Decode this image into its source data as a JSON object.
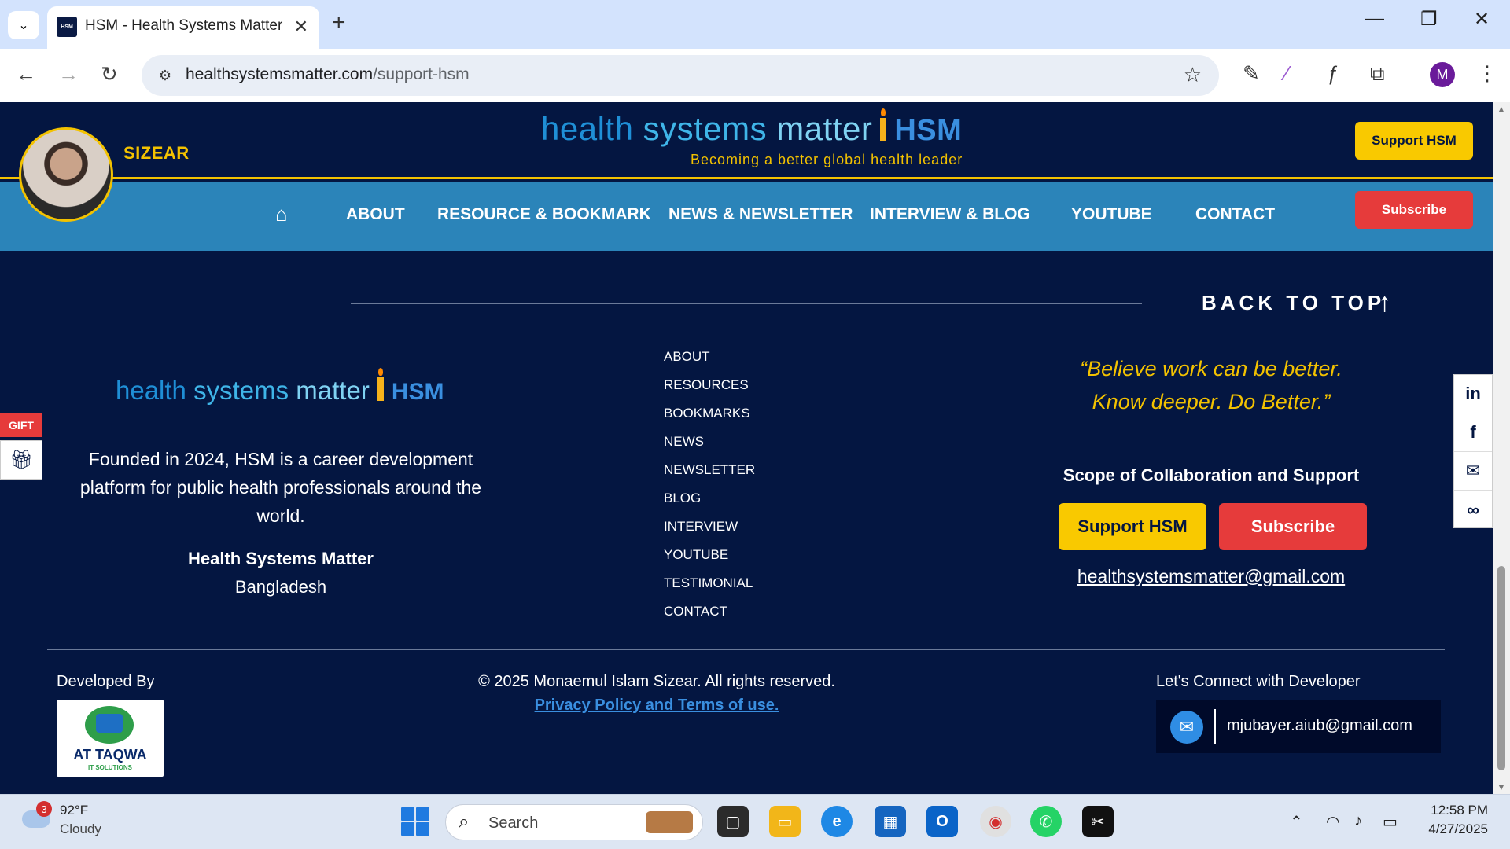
{
  "browser": {
    "tab_title": "HSM - Health Systems Matter",
    "favicon_text": "HSM",
    "url_domain": "healthsystemsmatter.com",
    "url_path": "/support-hsm",
    "profile_initial": "M"
  },
  "header": {
    "profile_name": "SIZEAR",
    "brand_w1": "health",
    "brand_w2": "systems",
    "brand_w3": "matter",
    "brand_hsm": "HSM",
    "tagline": "Becoming a better global health leader",
    "support_label": "Support HSM"
  },
  "nav": {
    "items": [
      "ABOUT",
      "RESOURCE & BOOKMARK",
      "NEWS & NEWSLETTER",
      "INTERVIEW & BLOG",
      "YOUTUBE",
      "CONTACT"
    ],
    "subscribe_label": "Subscribe"
  },
  "footer": {
    "back_to_top": "BACK TO TOP",
    "brand_w1": "health",
    "brand_w2": "systems",
    "brand_w3": "matter",
    "brand_hsm": "HSM",
    "about_text": "Founded in 2024, HSM is a career development platform for public health professionals around the world.",
    "org_name": "Health Systems Matter",
    "org_country": "Bangladesh",
    "links": [
      "ABOUT",
      "RESOURCES",
      "BOOKMARKS",
      "NEWS",
      "NEWSLETTER",
      "BLOG",
      "INTERVIEW",
      "YOUTUBE",
      "TESTIMONIAL",
      "CONTACT"
    ],
    "quote_line1": "“Believe work can be better.",
    "quote_line2": "Know deeper. Do Better.”",
    "scope_title": "Scope of Collaboration and Support",
    "support_label": "Support HSM",
    "subscribe_label": "Subscribe",
    "email": "healthsystemsmatter@gmail.com",
    "developed_by": "Developed By",
    "dev_logo_line1": "AT TAQWA",
    "dev_logo_line2": "IT SOLUTIONS",
    "copyright": "© 2025 Monaemul Islam Sizear. All rights reserved.",
    "privacy": "Privacy Policy and Terms of use.",
    "connect_label": "Let's Connect with Developer",
    "dev_email": "mjubayer.aiub@gmail.com"
  },
  "widgets": {
    "gift_label": "GIFT",
    "share_icons": [
      "linkedin-icon",
      "facebook-icon",
      "email-icon",
      "link-icon"
    ]
  },
  "taskbar": {
    "weather_badge": "3",
    "temperature": "92°F",
    "condition": "Cloudy",
    "search_placeholder": "Search",
    "time": "12:58 PM",
    "date": "4/27/2025"
  },
  "colors": {
    "page_bg": "#041641",
    "nav_bg": "#2b84b9",
    "accent_yellow": "#f9c900",
    "accent_red": "#e63b3b",
    "link_blue": "#3a8fe0"
  }
}
